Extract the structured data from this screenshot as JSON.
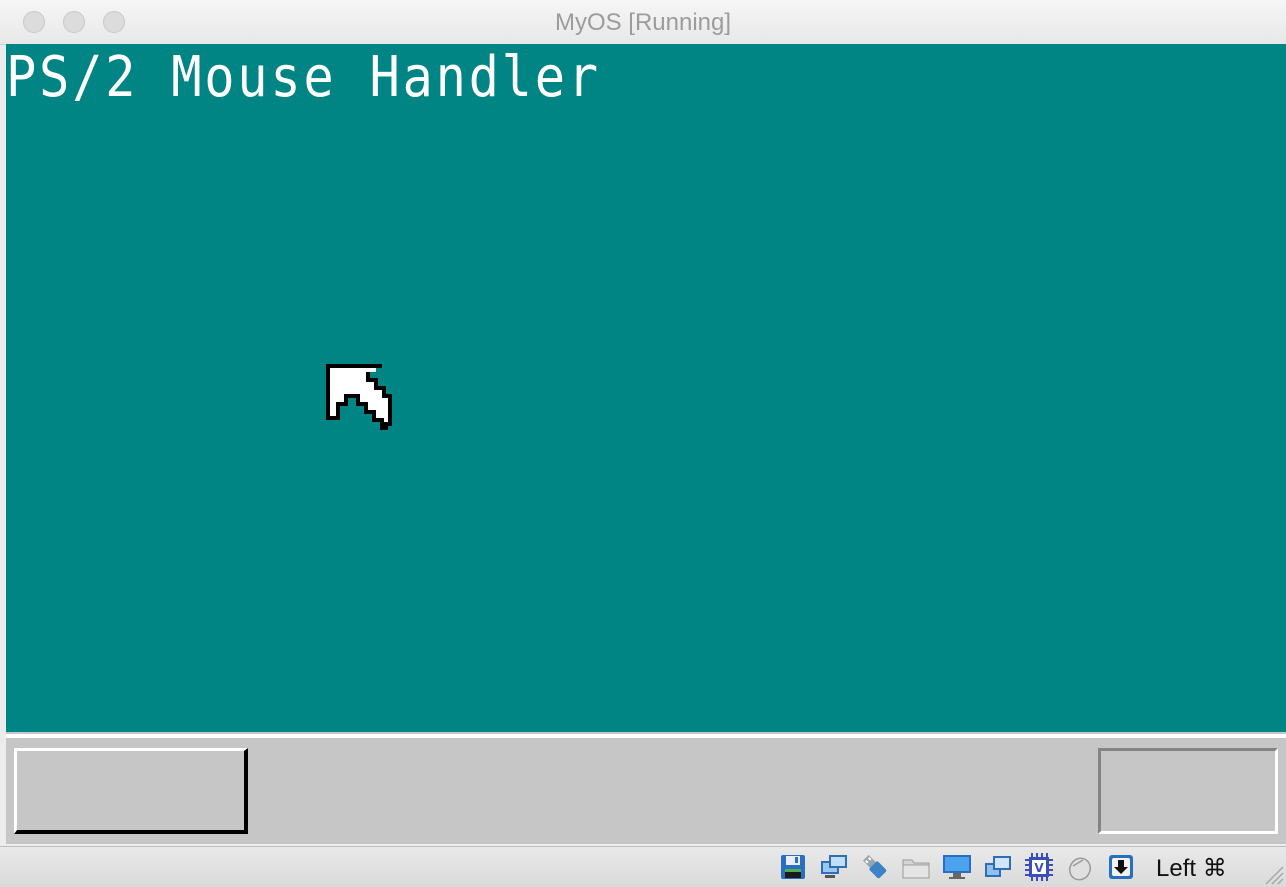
{
  "window": {
    "title": "MyOS [Running]"
  },
  "guest": {
    "heading": "PS/2 Mouse Handler",
    "desktop_color": "#008484",
    "taskbar_color": "#c6c6c6"
  },
  "statusbar": {
    "icons": [
      "floppy-icon",
      "network-icon",
      "usb-icon",
      "shared-folder-icon",
      "display-icon",
      "video-capture-icon",
      "cpu-icon",
      "mouse-integration-icon",
      "keyboard-capture-icon"
    ],
    "host_key": "Left ⌘"
  }
}
